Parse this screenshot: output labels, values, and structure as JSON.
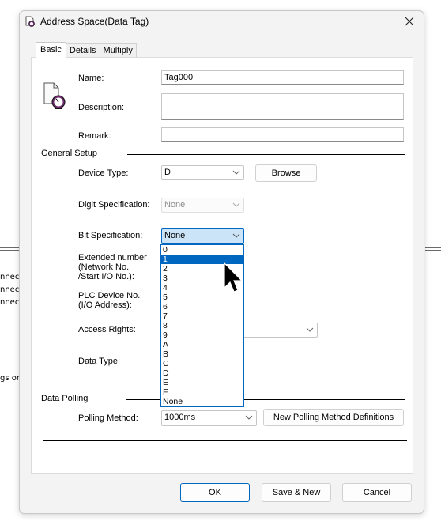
{
  "background": {
    "left_fragments": [
      "nnect",
      "nnect",
      "nnect",
      "gs or"
    ]
  },
  "dialog": {
    "title": "Address Space(Data Tag)",
    "title_icon": "data-tag-icon",
    "close_icon": "close-icon",
    "tabs": [
      {
        "label": "Basic",
        "active": true
      },
      {
        "label": "Details",
        "active": false
      },
      {
        "label": "Multiply",
        "active": false
      }
    ],
    "tag_icon": "data-tag-gauge-icon",
    "fields": {
      "name": {
        "label": "Name:",
        "value": "Tag000"
      },
      "description": {
        "label": "Description:",
        "value": ""
      },
      "remark": {
        "label": "Remark:",
        "value": ""
      }
    },
    "general_setup": {
      "heading": "General Setup",
      "device_type": {
        "label": "Device Type:",
        "value": "D",
        "browse_label": "Browse"
      },
      "digit_spec": {
        "label": "Digit Specification:",
        "value": "None",
        "disabled": true
      },
      "bit_spec": {
        "label": "Bit Specification:",
        "value": "None"
      },
      "extended_number": {
        "label_lines": [
          "Extended number",
          "(Network No.",
          "/Start I/O No.):"
        ]
      },
      "plc_device_no": {
        "label_lines": [
          "PLC Device No.",
          "(I/O Address):"
        ]
      },
      "access_rights": {
        "label": "Access Rights:",
        "value": ""
      },
      "data_type": {
        "label": "Data Type:"
      }
    },
    "bit_spec_dropdown": {
      "options": [
        "0",
        "1",
        "2",
        "3",
        "4",
        "5",
        "6",
        "7",
        "8",
        "9",
        "A",
        "B",
        "C",
        "D",
        "E",
        "F",
        "None"
      ],
      "highlighted": "1"
    },
    "data_polling": {
      "heading": "Data Polling",
      "polling_method": {
        "label": "Polling Method:",
        "value": "1000ms",
        "new_def_label": "New Polling Method Definitions"
      }
    },
    "buttons": {
      "ok": "OK",
      "save_new": "Save & New",
      "cancel": "Cancel"
    }
  },
  "colors": {
    "accent": "#0067c0",
    "focus_fill": "#cce4f7",
    "dialog_bg": "#f3f3f3"
  }
}
